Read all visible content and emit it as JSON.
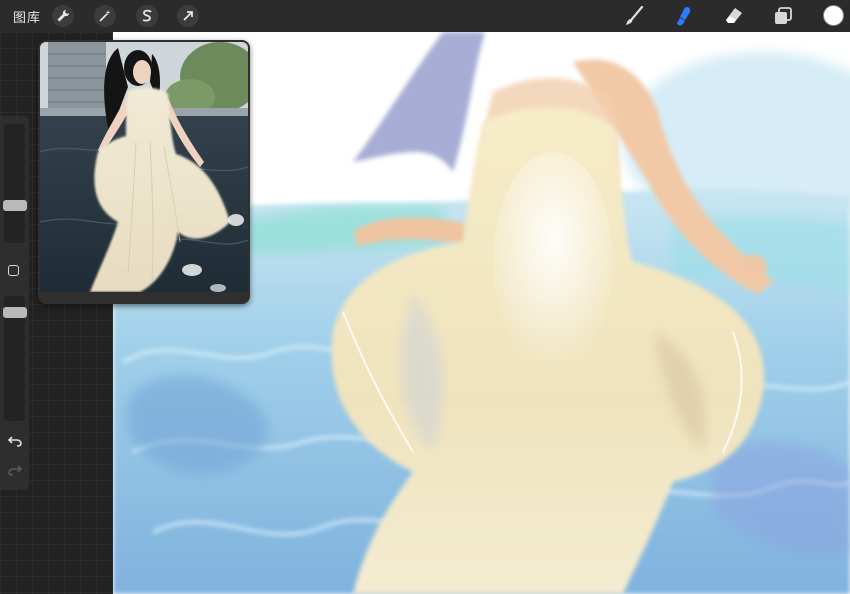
{
  "toolbar": {
    "gallery_label": "图库",
    "left_tools": [
      "wrench-icon",
      "magic-wand-icon",
      "selection-icon",
      "transform-arrow-icon"
    ],
    "right_tools": [
      "brush-icon",
      "smudge-icon",
      "eraser-icon",
      "layers-icon"
    ],
    "active_tool": "smudge-icon",
    "active_color": "#ffffff",
    "accent_color": "#2f7bff"
  },
  "sidebar": {
    "brush_size_level": 0.3,
    "opacity_level": 0.1,
    "controls": [
      "modify-button",
      "undo-icon",
      "redo-icon"
    ]
  },
  "reference_window": {
    "content": "reference photo"
  }
}
